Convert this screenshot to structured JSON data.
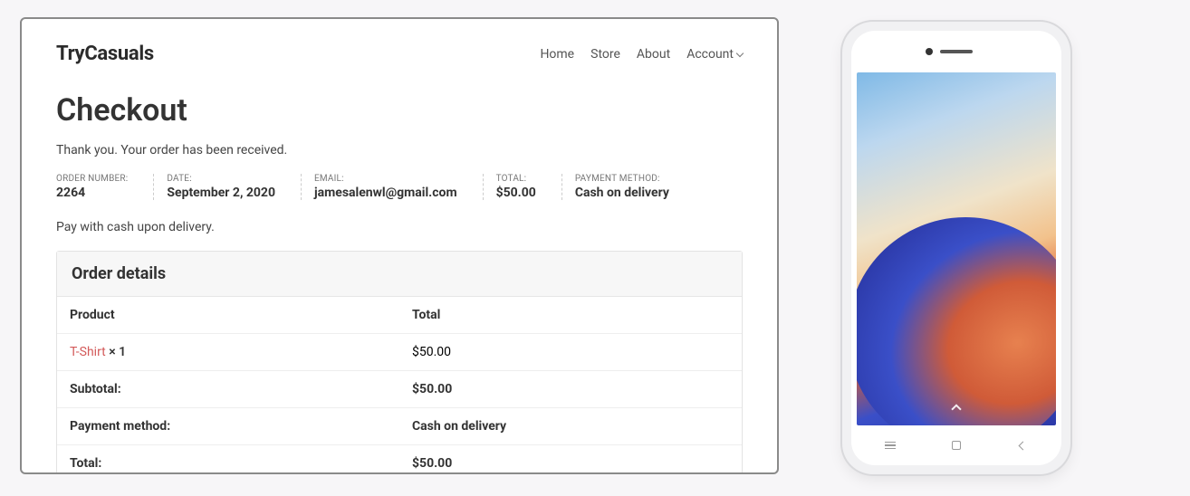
{
  "site": {
    "title": "TryCasuals",
    "nav": [
      "Home",
      "Store",
      "About",
      "Account"
    ]
  },
  "page": {
    "title": "Checkout",
    "thankyou": "Thank you. Your order has been received.",
    "pay_note": "Pay with cash upon delivery."
  },
  "meta": {
    "order_number_label": "ORDER NUMBER:",
    "order_number": "2264",
    "date_label": "DATE:",
    "date": "September 2, 2020",
    "email_label": "EMAIL:",
    "email": "jamesalenwl@gmail.com",
    "total_label": "TOTAL:",
    "total": "$50.00",
    "payment_method_label": "PAYMENT METHOD:",
    "payment_method": "Cash on delivery"
  },
  "order_details": {
    "heading": "Order details",
    "col_product": "Product",
    "col_total": "Total",
    "line_product": "T-Shirt",
    "line_qty": " × 1",
    "line_total": "$50.00",
    "subtotal_label": "Subtotal:",
    "subtotal_value": "$50.00",
    "payment_label": "Payment method:",
    "payment_value": "Cash on delivery",
    "total_label": "Total:",
    "total_value": "$50.00"
  }
}
